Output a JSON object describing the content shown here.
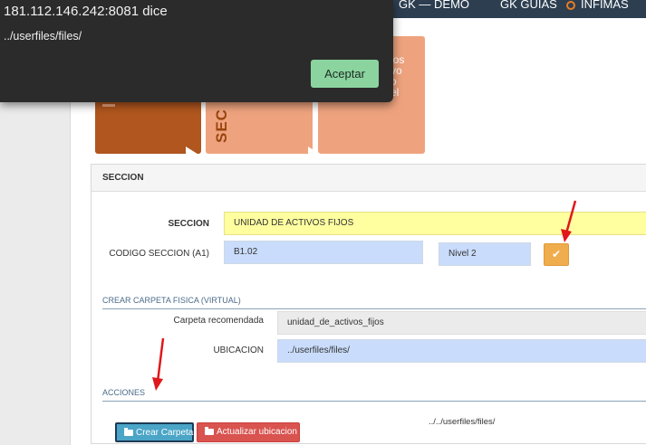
{
  "nav": {
    "items": [
      {
        "label": "GK — DEMO"
      },
      {
        "label": "GK GUIAS"
      },
      {
        "label": "INFIMAS"
      }
    ]
  },
  "alert": {
    "title": "181.112.146.242:8081 dice",
    "message": "../userfiles/files/",
    "ok_label": "Aceptar"
  },
  "tiles": {
    "vertical_text": "SEC",
    "partial_text": "los\nvo\no\nel"
  },
  "panel": {
    "title": "SECCION",
    "seccion_label": "SECCION",
    "seccion_value": "UNIDAD DE ACTIVOS FIJOS",
    "codigo_label": "CODIGO SECCION (A1)",
    "codigo_value": "B1.02",
    "nivel_value": "Nivel 2",
    "crear_section": "CREAR CARPETA FISICA (VIRTUAL)",
    "carpeta_label": "Carpeta recomendada",
    "carpeta_value": "unidad_de_activos_fijos",
    "ubicacion_label": "UBICACION",
    "ubicacion_value": "../userfiles/files/",
    "acciones_section": "ACCIONES",
    "path_text": "../../userfiles/files/",
    "crear_button": "Crear Carpeta",
    "actualizar_button": "Actualizar ubicacion"
  },
  "colors": {
    "accent_primary": "#4aa5c7",
    "danger": "#d9534f",
    "warning": "#f0ad4e",
    "highlight_field": "#ffffa0",
    "input_blue": "#c9dcfb",
    "annotation": "#e0181b"
  }
}
